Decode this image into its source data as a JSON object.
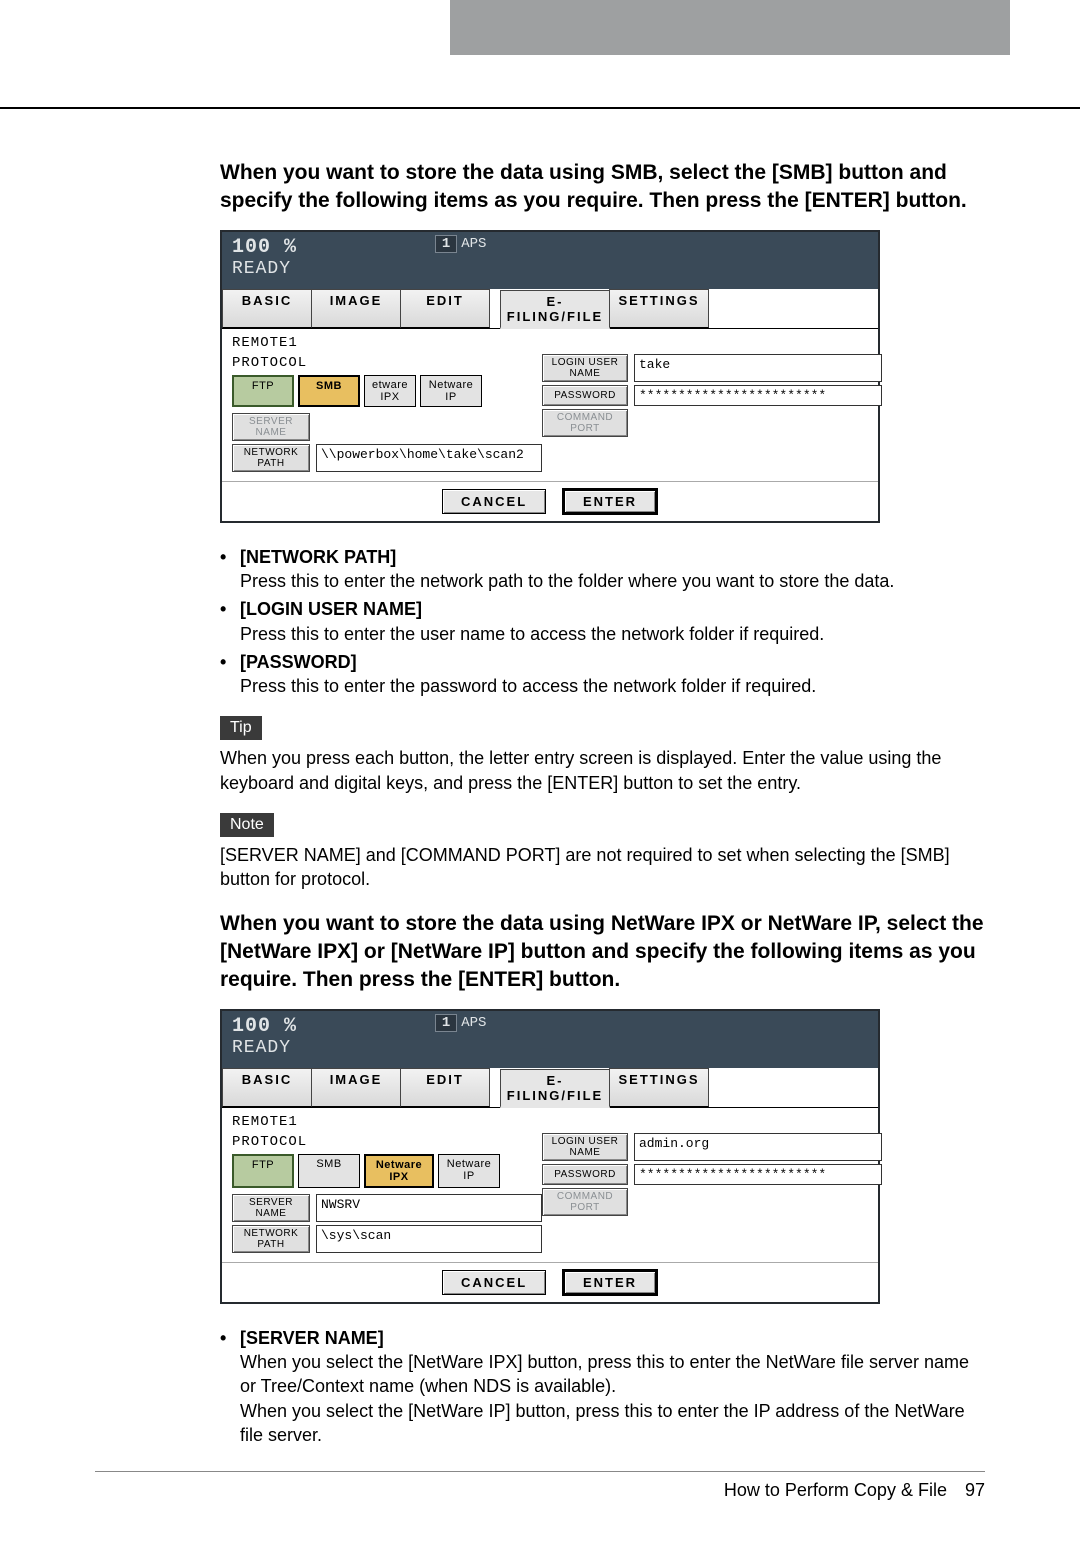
{
  "section1": {
    "heading": "When you want to store the data using SMB, select the [SMB] button and specify the following items as you require. Then press the [ENTER] button."
  },
  "panel1": {
    "percent": "100 %",
    "aps_num": "1",
    "aps": "APS",
    "ready": "READY",
    "tabs": {
      "basic": "BASIC",
      "image": "IMAGE",
      "edit": "EDIT",
      "efile": "E-FILING/FILE",
      "settings": "SETTINGS"
    },
    "remote": "REMOTE1",
    "protocol_label": "PROTOCOL",
    "protocol": {
      "ftp": "FTP",
      "smb": "SMB",
      "nwipx_cut": "etware IPX",
      "nwip": "Netware IP"
    },
    "server_name_label": "SERVER NAME",
    "network_path_label": "NETWORK PATH",
    "network_path": "\\\\powerbox\\home\\take\\scan2",
    "login_user_label": "LOGIN USER NAME",
    "login_user": "take",
    "password_label": "PASSWORD",
    "password": "************************",
    "command_port_label": "COMMAND PORT",
    "cancel": "CANCEL",
    "enter": "ENTER"
  },
  "bullets1": [
    {
      "title": "[NETWORK PATH]",
      "text": "Press this to enter the network path to the folder where you want to store the data."
    },
    {
      "title": "[LOGIN USER NAME]",
      "text": "Press this to enter the user name to access the network folder if required."
    },
    {
      "title": "[PASSWORD]",
      "text": "Press this to enter the password to access the network folder if required."
    }
  ],
  "tip": {
    "label": "Tip",
    "text": "When you press each button, the letter entry screen is displayed. Enter the value using the keyboard and digital keys, and press the [ENTER] button to set the entry."
  },
  "note": {
    "label": "Note",
    "text": "[SERVER NAME] and [COMMAND PORT] are not required to set when selecting the [SMB] button for protocol."
  },
  "section2": {
    "heading": "When you want to store the data using NetWare IPX or NetWare IP, select the [NetWare IPX] or [NetWare IP] button and specify the following items as you require. Then press the [ENTER] button."
  },
  "panel2": {
    "percent": "100 %",
    "aps_num": "1",
    "aps": "APS",
    "ready": "READY",
    "tabs": {
      "basic": "BASIC",
      "image": "IMAGE",
      "edit": "EDIT",
      "efile": "E-FILING/FILE",
      "settings": "SETTINGS"
    },
    "remote": "REMOTE1",
    "protocol_label": "PROTOCOL",
    "protocol": {
      "ftp": "FTP",
      "smb": "SMB",
      "nwipx": "Netware IPX",
      "nwip": "Netware IP"
    },
    "server_name_label": "SERVER NAME",
    "server_name": "NWSRV",
    "network_path_label": "NETWORK PATH",
    "network_path": "\\sys\\scan",
    "login_user_label": "LOGIN USER NAME",
    "login_user": "admin.org",
    "password_label": "PASSWORD",
    "password": "************************",
    "command_port_label": "COMMAND PORT",
    "cancel": "CANCEL",
    "enter": "ENTER"
  },
  "bullets2": [
    {
      "title": "[SERVER NAME]",
      "text1": "When you select the [NetWare IPX] button, press this to enter the NetWare file server name or Tree/Context name (when NDS is available).",
      "text2": "When you select the [NetWare IP] button, press this to enter the IP address of the NetWare file server."
    }
  ],
  "footer": {
    "text": "How to Perform Copy & File",
    "page": "97"
  }
}
